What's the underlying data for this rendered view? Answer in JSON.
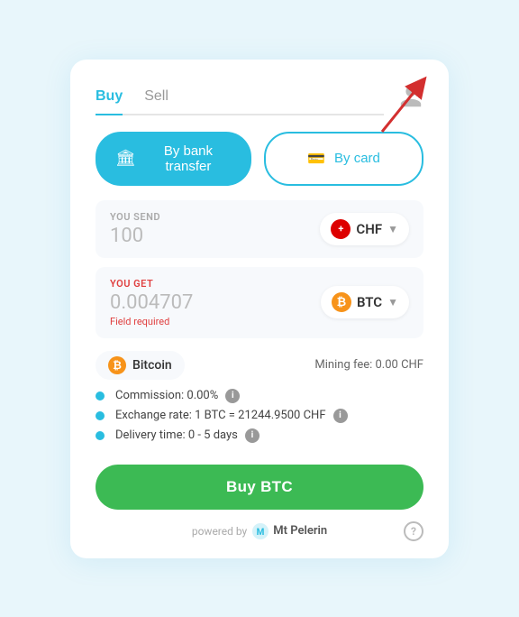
{
  "tabs": {
    "buy": "Buy",
    "sell": "Sell"
  },
  "active_tab": "buy",
  "payment": {
    "bank_label": "By bank transfer",
    "card_label": "By card"
  },
  "send": {
    "label": "YOU SEND",
    "value": "100",
    "currency": "CHF",
    "currency_flag": "+"
  },
  "get": {
    "label": "YOU GET",
    "value": "0.004707",
    "currency": "BTC",
    "field_required": "Field required"
  },
  "bitcoin_badge": "Bitcoin",
  "mining_fee": "Mining fee: 0.00 CHF",
  "details": [
    {
      "text": "Commission: 0.00%",
      "has_info": true
    },
    {
      "text": "Exchange rate: 1 BTC = 21244.9500 CHF",
      "has_info": true
    },
    {
      "text": "Delivery time: 0 - 5 days",
      "has_info": true
    }
  ],
  "buy_button": "Buy BTC",
  "footer": {
    "powered_by": "powered by",
    "brand": "Mt\nPelerin"
  }
}
